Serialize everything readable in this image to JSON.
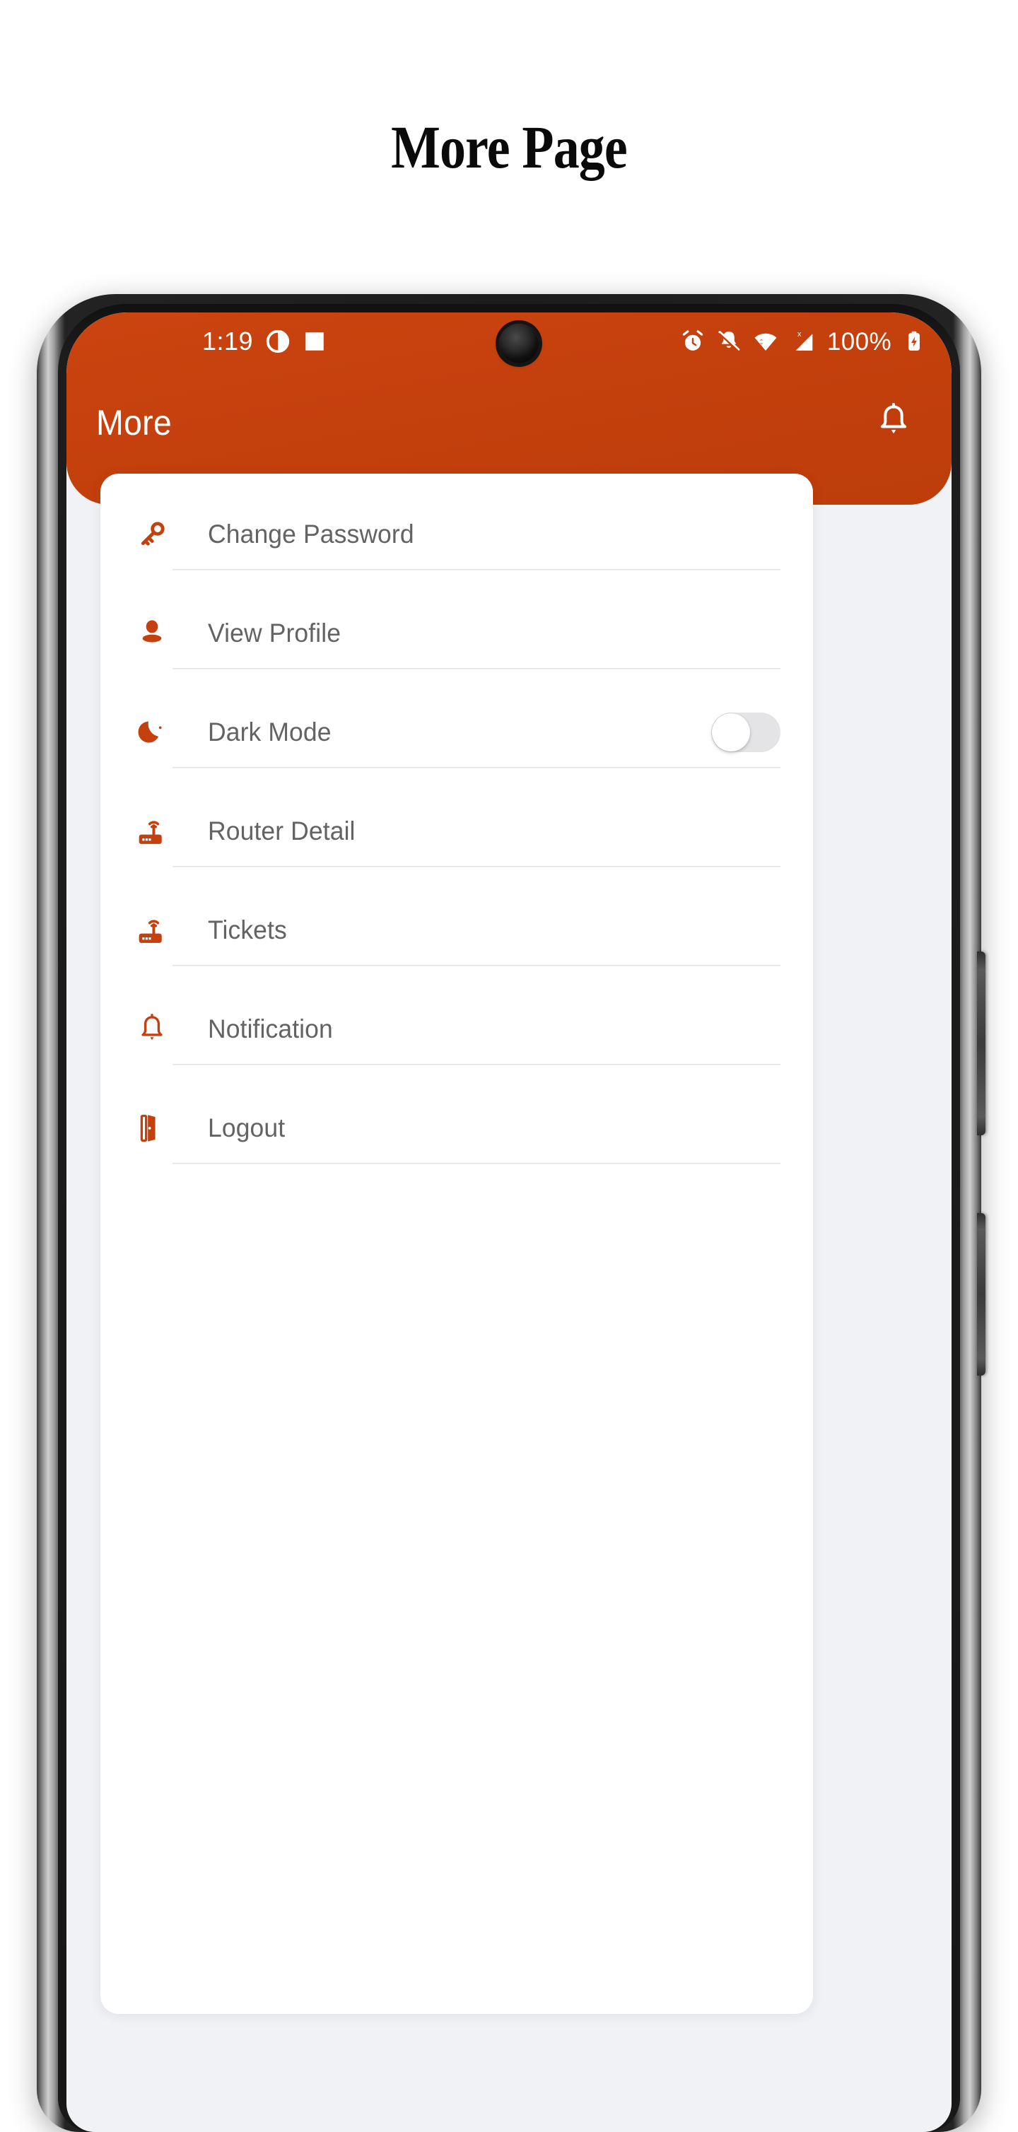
{
  "page": {
    "heading": "More Page"
  },
  "status_bar": {
    "time": "1:19",
    "battery_percent": "100%",
    "left_icons": [
      "screen-record-icon",
      "stop-square-icon"
    ],
    "right_icons": [
      "alarm-icon",
      "bell-muted-icon",
      "wifi-icon",
      "signal-no-sim-icon",
      "battery-charging-icon"
    ]
  },
  "app_bar": {
    "title": "More",
    "action_icon": "bell-icon"
  },
  "theme": {
    "primary": "#c4400d",
    "label_text": "#636363",
    "divider": "#e3e3e3",
    "card_background": "#ffffff",
    "screen_background": "#f1f2f5"
  },
  "menu": {
    "items": [
      {
        "label": "Change Password",
        "icon": "key-icon",
        "trailing": "none"
      },
      {
        "label": "View Profile",
        "icon": "person-icon",
        "trailing": "none"
      },
      {
        "label": "Dark Mode",
        "icon": "moon-stars-icon",
        "trailing": "toggle",
        "toggle_on": false
      },
      {
        "label": "Router Detail",
        "icon": "router-icon",
        "trailing": "none"
      },
      {
        "label": "Tickets",
        "icon": "router-icon",
        "trailing": "none"
      },
      {
        "label": "Notification",
        "icon": "bell-outline-icon",
        "trailing": "none"
      },
      {
        "label": "Logout",
        "icon": "logout-door-icon",
        "trailing": "none"
      }
    ]
  },
  "device": {
    "side_buttons": [
      "volume-rocker",
      "power-button"
    ],
    "camera": "punch-hole-camera"
  }
}
